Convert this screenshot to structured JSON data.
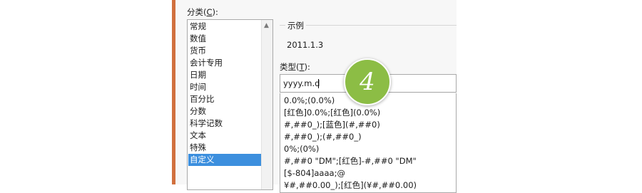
{
  "category": {
    "label_pre": "分类(",
    "label_key": "C",
    "label_post": "):",
    "items": [
      "常规",
      "数值",
      "货币",
      "会计专用",
      "日期",
      "时间",
      "百分比",
      "分数",
      "科学记数",
      "文本",
      "特殊",
      "自定义"
    ],
    "selected_index": 11
  },
  "sample": {
    "label": "示例",
    "value": "2011.1.3"
  },
  "type": {
    "label_pre": "类型(",
    "label_key": "T",
    "label_post": "):",
    "value": "yyyy.m.d"
  },
  "format_list": [
    "0.0%;(0.0%)",
    "[红色]0.0%;[红色](0.0%)",
    "#,##0_);[蓝色](#,##0)",
    "#,##0_);(#,##0_)",
    "0%;(0%)",
    "#,##0 \"DM\";[红色]-#,##0 \"DM\"",
    "[$-804]aaaa;@",
    "¥#,##0.00_);[红色](¥#,##0.00)"
  ],
  "step_badge": "4",
  "colors": {
    "accent_bar": "#d1703e",
    "selection": "#3c8fde",
    "badge": "#8cbd45"
  }
}
